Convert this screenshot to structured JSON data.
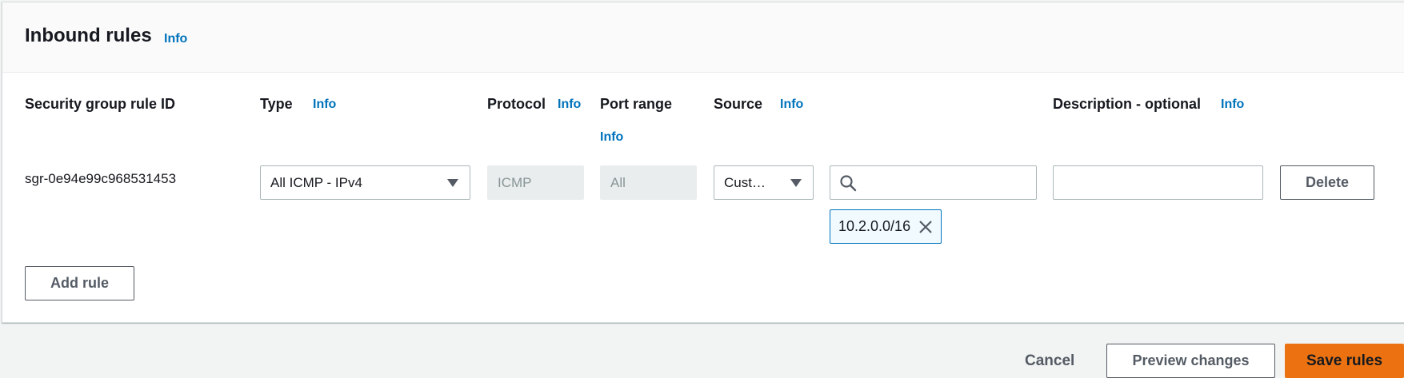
{
  "panel": {
    "title": "Inbound rules",
    "info_label": "Info"
  },
  "columns": {
    "rule_id": "Security group rule ID",
    "type": "Type",
    "protocol": "Protocol",
    "port_range": "Port range",
    "source": "Source",
    "description": "Description - optional",
    "info_label": "Info"
  },
  "rule": {
    "id": "sgr-0e94e99c968531453",
    "type_value": "All ICMP - IPv4",
    "protocol_value": "ICMP",
    "port_range_value": "All",
    "source_value": "Cust…",
    "source_search_value": "",
    "source_token": "10.2.0.0/16",
    "description_value": "",
    "delete_label": "Delete"
  },
  "actions": {
    "add_rule_label": "Add rule",
    "cancel_label": "Cancel",
    "preview_label": "Preview changes",
    "save_label": "Save rules"
  },
  "colors": {
    "link": "#0073bb",
    "primary": "#ec7211",
    "token_border": "#0073bb"
  }
}
